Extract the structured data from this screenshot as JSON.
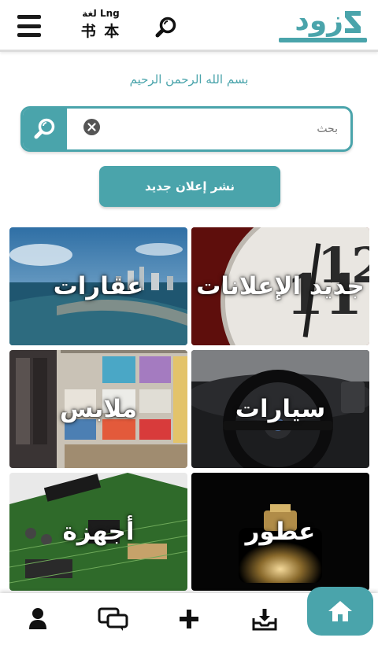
{
  "header": {
    "lang_label_top": "لغة Lng",
    "lang_label_bottom": "书 本",
    "logo_text": "زود"
  },
  "bismillah": "بسم الله الرحمن الرحيم",
  "search": {
    "placeholder": "بحث",
    "value": ""
  },
  "post_ad_label": "نشر إعلان جديد",
  "categories": [
    {
      "label": "جديد الإعلانات",
      "theme": "clock"
    },
    {
      "label": "عقارات",
      "theme": "city"
    },
    {
      "label": "سيارات",
      "theme": "car"
    },
    {
      "label": "ملابس",
      "theme": "clothes"
    },
    {
      "label": "عطور",
      "theme": "perfume"
    },
    {
      "label": "أجهزة",
      "theme": "electronics"
    }
  ],
  "colors": {
    "accent": "#4aa4ab",
    "text_dark": "#111111"
  },
  "icons": {
    "menu": "hamburger-icon",
    "search": "magnifier-icon",
    "clear": "clear-x-icon",
    "profile": "person-icon",
    "chat": "chat-bubbles-icon",
    "add": "plus-icon",
    "inbox": "download-tray-icon",
    "home": "home-icon"
  }
}
